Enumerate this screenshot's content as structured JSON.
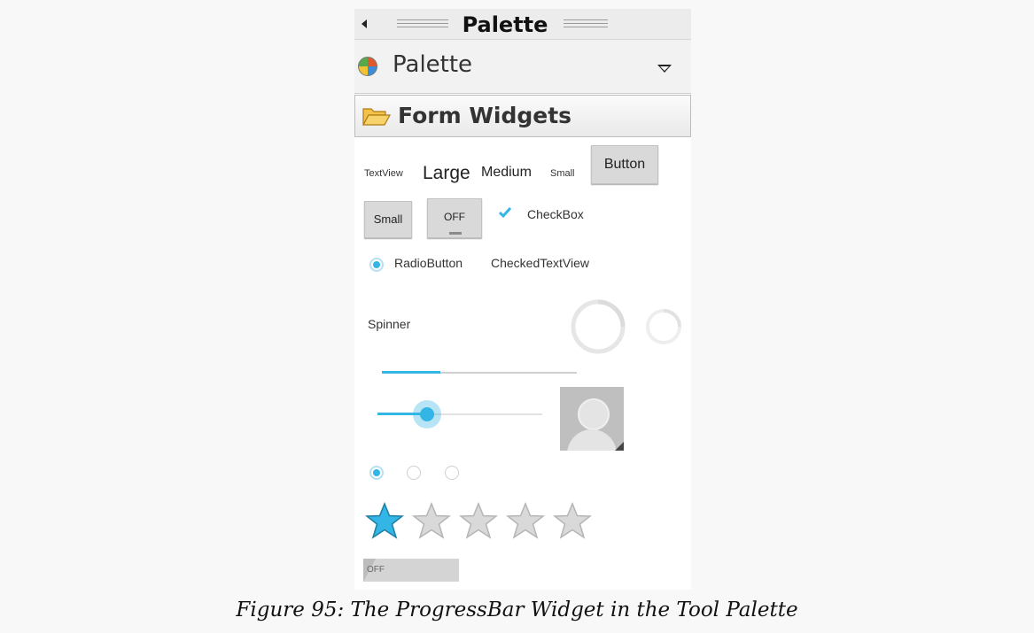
{
  "window": {
    "title": "Palette"
  },
  "palette_selector": {
    "label": "Palette",
    "icon": "palette-icon",
    "dropdown_icon": "chevron-down-icon"
  },
  "section": {
    "title": "Form Widgets",
    "icon": "folder-open-icon"
  },
  "widgets": {
    "row1": {
      "textview": "TextView",
      "large": "Large",
      "medium": "Medium",
      "small": "Small",
      "button": "Button"
    },
    "row2": {
      "small_button": "Small",
      "toggle_button": "OFF",
      "checkbox": "CheckBox",
      "checkbox_checked": true
    },
    "row3": {
      "radio_button": "RadioButton",
      "checked_text_view": "CheckedTextView"
    },
    "row4": {
      "spinner": "Spinner"
    },
    "progress_bar_horizontal_fraction": 0.3,
    "seek_bar_fraction": 0.3,
    "radio_group_selected_index": 0,
    "radio_group_count": 3,
    "rating_bar": {
      "rating": 1,
      "max": 5
    },
    "switch": {
      "label": "OFF"
    }
  },
  "colors": {
    "accent": "#33b5e5",
    "star_empty": "#d9d9d9"
  },
  "caption": "Figure 95: The ProgressBar Widget in the Tool Palette"
}
